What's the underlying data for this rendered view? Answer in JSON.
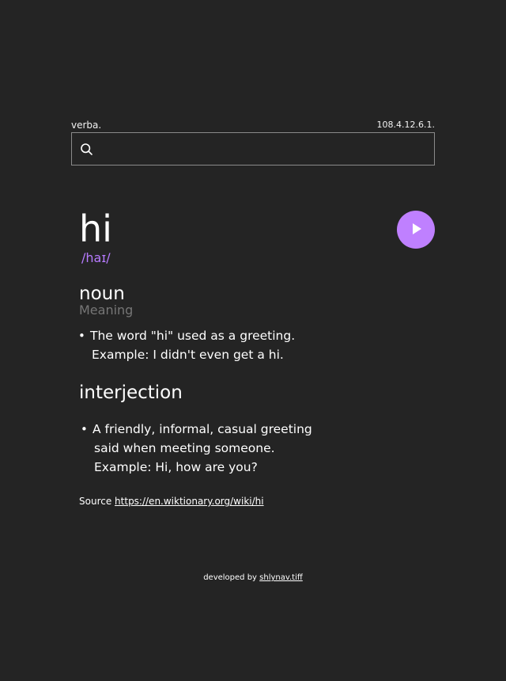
{
  "header": {
    "brand": "verba.",
    "version": "108.4.12.6.1."
  },
  "search": {
    "icon": "search-icon",
    "value": "",
    "placeholder": ""
  },
  "entry": {
    "word": "hi",
    "phonetic": "/haɪ/",
    "play_icon": "play-icon",
    "accent_color": "#bf80ff",
    "meanings": [
      {
        "part_of_speech": "noun",
        "label": "Meaning",
        "definitions": [
          {
            "text": "The word \"hi\" used as a greeting.",
            "example": "Example: I didn't even get a hi."
          }
        ]
      },
      {
        "part_of_speech": "interjection",
        "definitions": [
          {
            "line1": "A friendly, informal, casual greeting",
            "line2": "said when meeting someone.",
            "example": "Example: Hi, how are you?"
          }
        ]
      }
    ]
  },
  "source": {
    "label": "Source",
    "url": "https://en.wiktionary.org/wiki/hi"
  },
  "footer": {
    "prefix": "developed by",
    "author": "shlynav.tiff"
  }
}
